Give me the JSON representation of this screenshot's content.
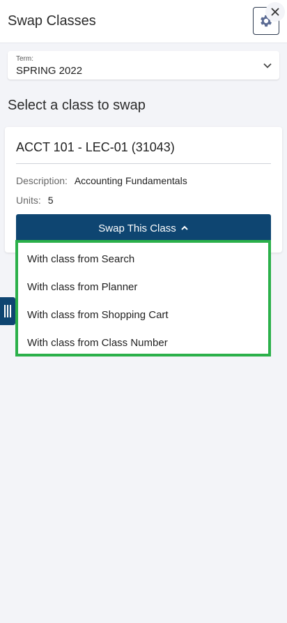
{
  "header": {
    "title": "Swap Classes",
    "settings_icon": "gear-icon",
    "close_icon": "close-icon"
  },
  "term": {
    "label": "Term:",
    "value": "SPRING 2022"
  },
  "section_title": "Select a class to swap",
  "class_card": {
    "title": "ACCT 101 - LEC-01 (31043)",
    "description_label": "Description:",
    "description_value": "Accounting Fundamentals",
    "units_label": "Units:",
    "units_value": "5"
  },
  "swap_button": {
    "label": "Swap This Class"
  },
  "swap_menu": {
    "items": [
      "With class from Search",
      "With class from Planner",
      "With class from Shopping Cart",
      "With class from Class Number"
    ]
  },
  "colors": {
    "primary": "#0e4571",
    "highlight": "#2bb04a",
    "background": "#f3f4f8"
  }
}
